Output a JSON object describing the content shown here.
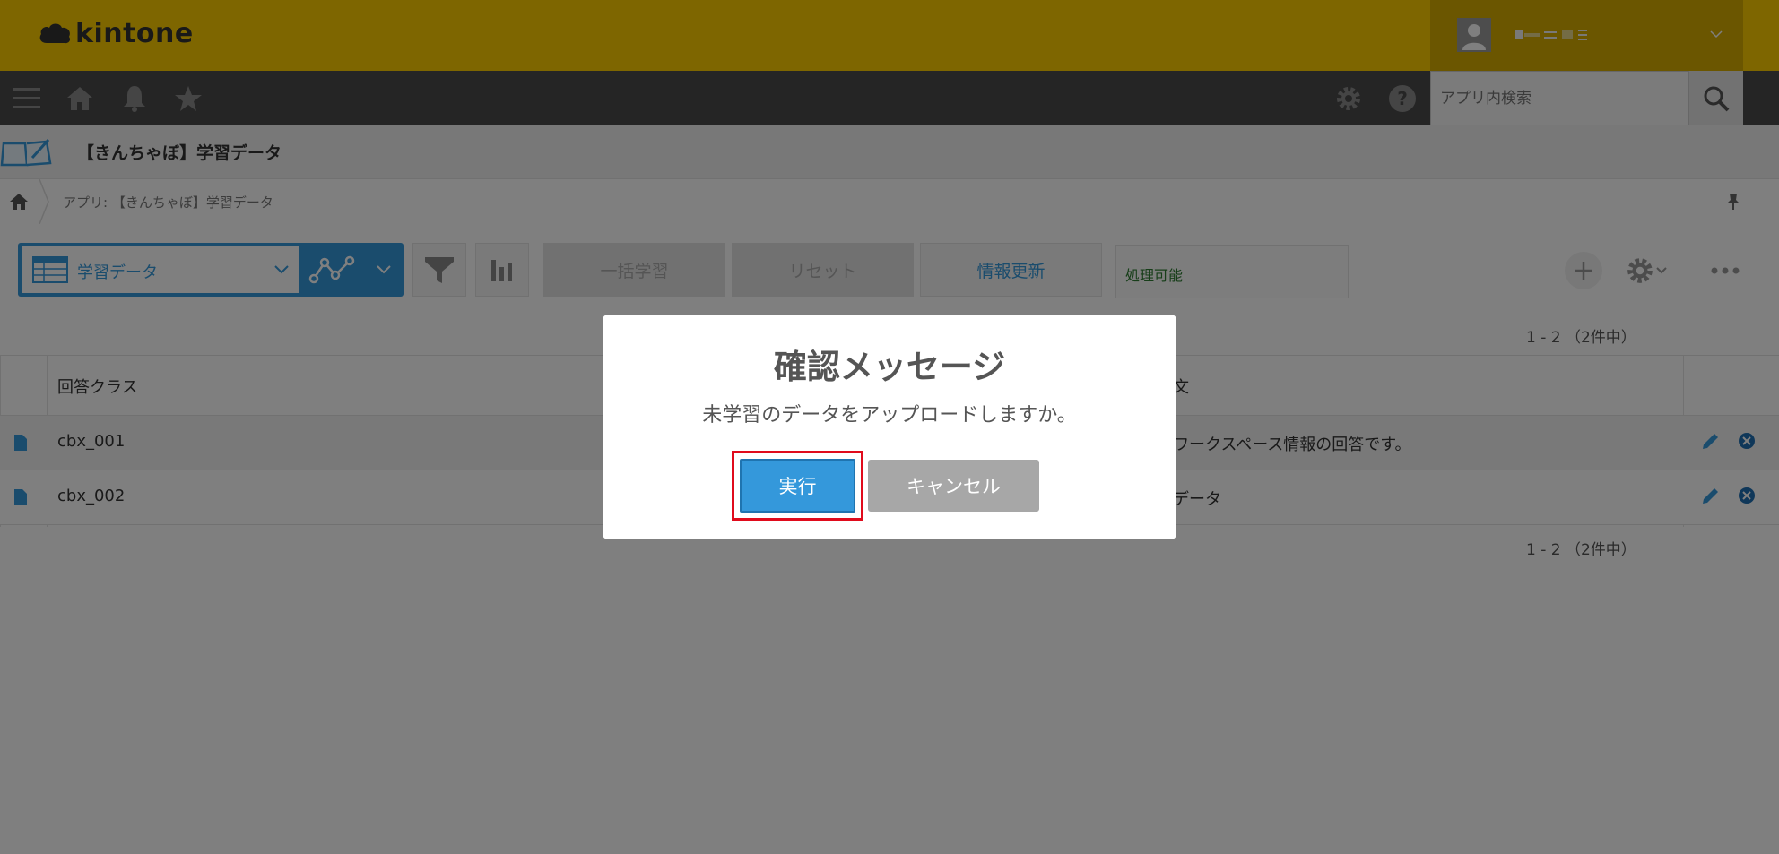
{
  "header": {
    "logo_text": "kintone",
    "user_name": ""
  },
  "navbar": {
    "search_placeholder": "アプリ内検索"
  },
  "app": {
    "title": "【きんちゃぼ】学習データ"
  },
  "breadcrumb": {
    "text": "アプリ: 【きんちゃぼ】学習データ"
  },
  "toolbar": {
    "view_label": "学習データ",
    "bulk_learn_label": "一括学習",
    "reset_label": "リセット",
    "update_label": "情報更新",
    "status_text": "処理可能"
  },
  "pagination": {
    "top": "1 - 2 （2件中）",
    "bottom": "1 - 2 （2件中）"
  },
  "table": {
    "columns": [
      "回答クラス",
      "文"
    ],
    "rows": [
      {
        "class": "cbx_001",
        "text": "ワークスペース情報の回答です。"
      },
      {
        "class": "cbx_002",
        "text": "データ"
      }
    ]
  },
  "dialog": {
    "title": "確認メッセージ",
    "message": "未学習のデータをアップロードしますか。",
    "ok_label": "実行",
    "cancel_label": "キャンセル"
  },
  "colors": {
    "header_yellow": "#fccc00",
    "nav_dark": "#4b4b4b",
    "accent_blue": "#3498db",
    "highlight_red": "#e00b1c"
  }
}
